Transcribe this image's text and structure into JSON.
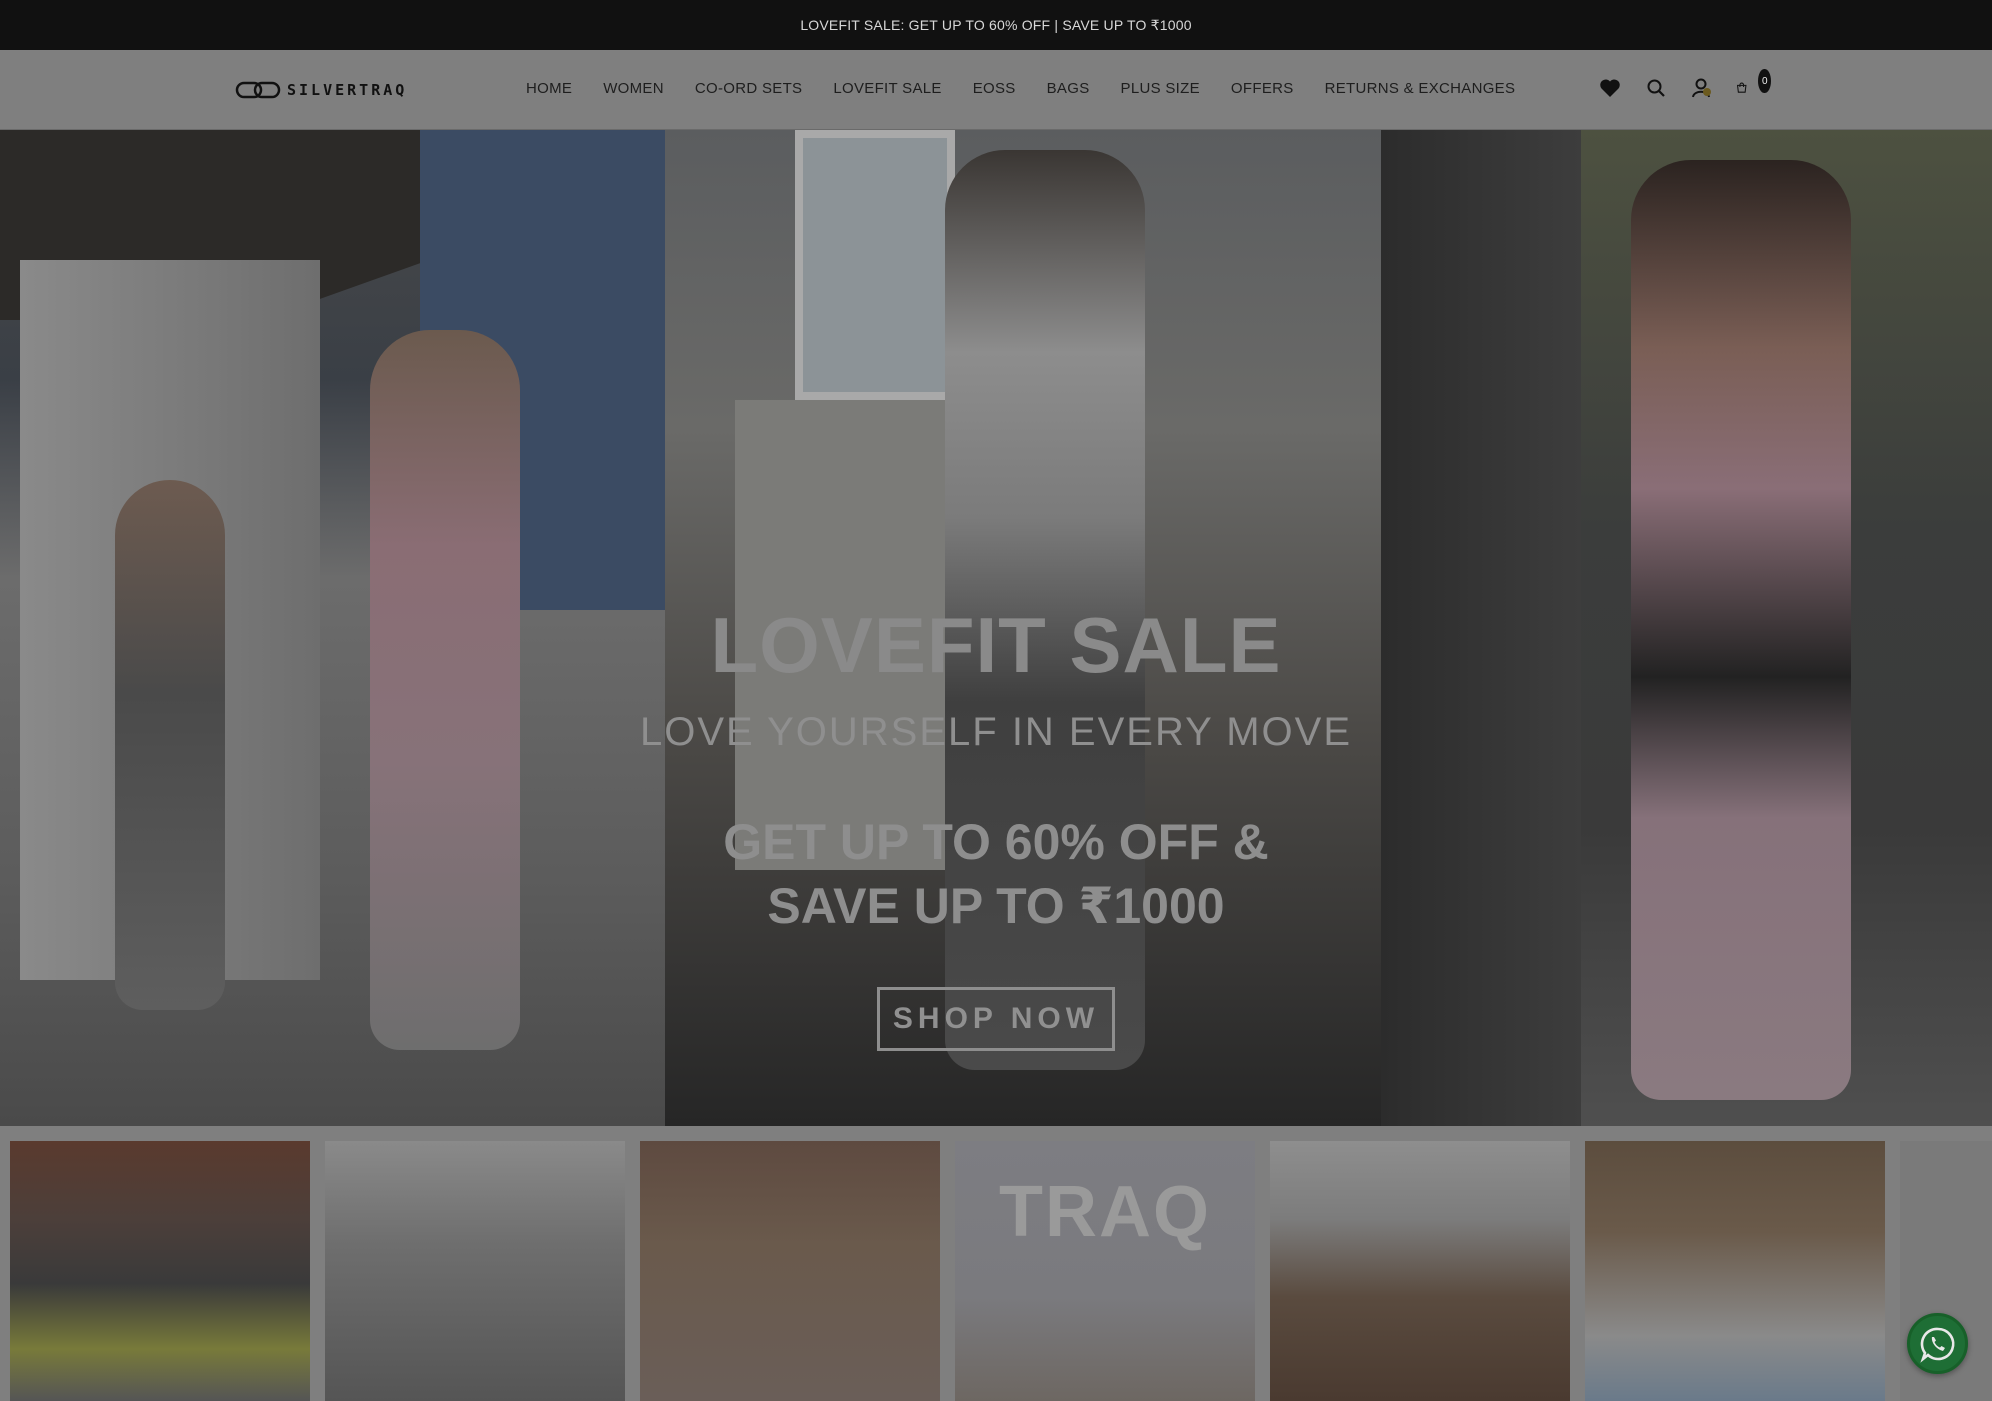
{
  "announcement": "LOVEFIT SALE: GET UP TO 60% OFF | SAVE UP TO ₹1000",
  "brand": {
    "name": "SILVERTRAQ"
  },
  "nav": [
    {
      "label": "HOME"
    },
    {
      "label": "WOMEN"
    },
    {
      "label": "CO-ORD SETS"
    },
    {
      "label": "LOVEFIT SALE"
    },
    {
      "label": "EOSS"
    },
    {
      "label": "BAGS"
    },
    {
      "label": "PLUS SIZE"
    },
    {
      "label": "OFFERS"
    },
    {
      "label": "RETURNS & EXCHANGES"
    }
  ],
  "header_icons": {
    "wishlist": "heart-icon",
    "search": "search-icon",
    "account": "user-icon",
    "cart": "cart-icon",
    "cart_count": "0"
  },
  "hero": {
    "title": "LOVEFIT SALE",
    "subtitle": "LOVE YOURSELF IN EVERY MOVE",
    "offer_line1": "GET UP TO 60% OFF &",
    "offer_line2": "SAVE UP TO ₹1000",
    "cta": "SHOP NOW"
  },
  "strip": {
    "tiles": [
      {
        "label": ""
      },
      {
        "label": ""
      },
      {
        "label": ""
      },
      {
        "label": "TRAQ"
      },
      {
        "label": ""
      },
      {
        "label": ""
      }
    ]
  },
  "whatsapp": {
    "icon": "whatsapp-icon"
  },
  "colors": {
    "announcement_bg": "#111111",
    "overlay": "#7f7f7f",
    "whatsapp": "#1e6e35"
  }
}
